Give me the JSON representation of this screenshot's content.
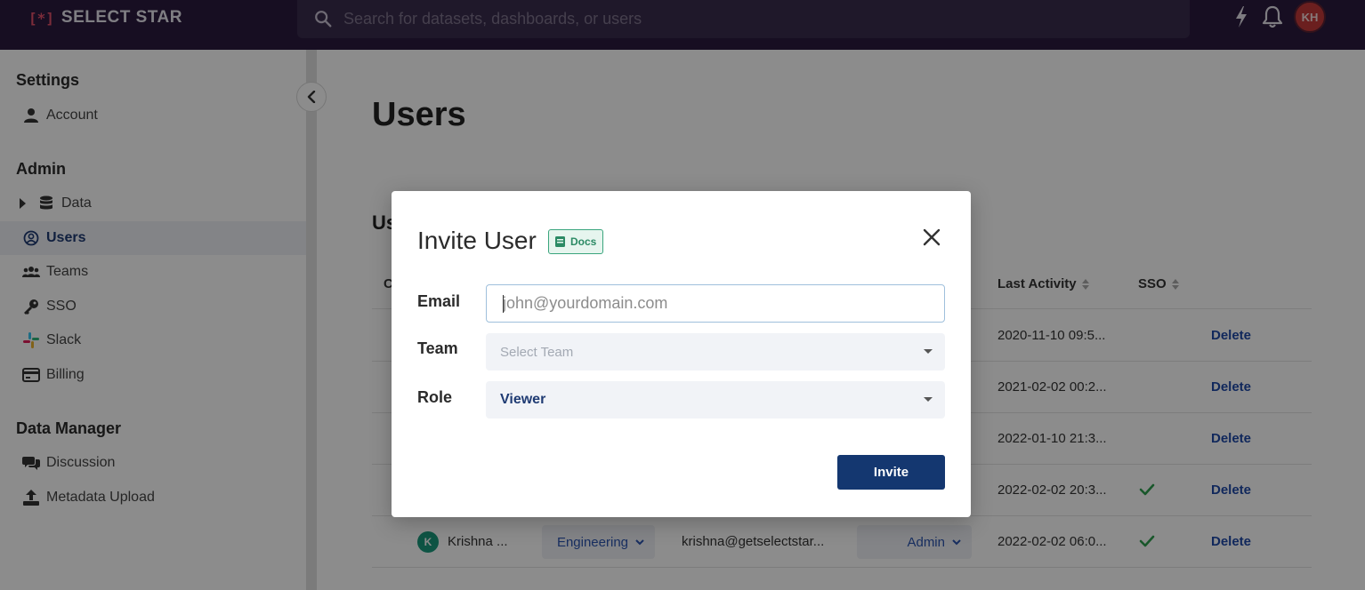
{
  "brand": {
    "mark": "[*]",
    "name": "SELECT STAR"
  },
  "search": {
    "placeholder": "Search for datasets, dashboards, or users"
  },
  "topbar": {
    "avatar_initials": "KH"
  },
  "sidebar": {
    "settings_title": "Settings",
    "account": "Account",
    "admin_title": "Admin",
    "data": "Data",
    "users": "Users",
    "teams": "Teams",
    "sso": "SSO",
    "slack": "Slack",
    "billing": "Billing",
    "data_manager_title": "Data Manager",
    "discussion": "Discussion",
    "metadata_upload": "Metadata Upload"
  },
  "main": {
    "page_title": "Users",
    "section_title": "Us",
    "columns": {
      "first": "C",
      "last_activity": "Last Activity",
      "sso": "SSO"
    },
    "rows": [
      {
        "last_activity": "2020-11-10 09:5...",
        "sso": false,
        "action": "Delete"
      },
      {
        "last_activity": "2021-02-02 00:2...",
        "sso": false,
        "action": "Delete"
      },
      {
        "last_activity": "2022-01-10 21:3...",
        "sso": false,
        "action": "Delete"
      },
      {
        "last_activity": "2022-02-02 20:3...",
        "sso": true,
        "action": "Delete"
      },
      {
        "initial": "K",
        "name": "Krishna ...",
        "team": "Engineering",
        "email": "krishna@getselectstar...",
        "role": "Admin",
        "last_activity": "2022-02-02 06:0...",
        "sso": true,
        "action": "Delete"
      }
    ]
  },
  "modal": {
    "title": "Invite User",
    "docs_label": "Docs",
    "email_label": "Email",
    "email_placeholder": "john@yourdomain.com",
    "team_label": "Team",
    "team_placeholder": "Select Team",
    "role_label": "Role",
    "role_value": "Viewer",
    "invite_label": "Invite"
  },
  "colors": {
    "topbar": "#2a1a3e",
    "primary": "#143770",
    "accent": "#e2506b",
    "success": "#2f9e4f",
    "docs": "#3aa57d"
  }
}
